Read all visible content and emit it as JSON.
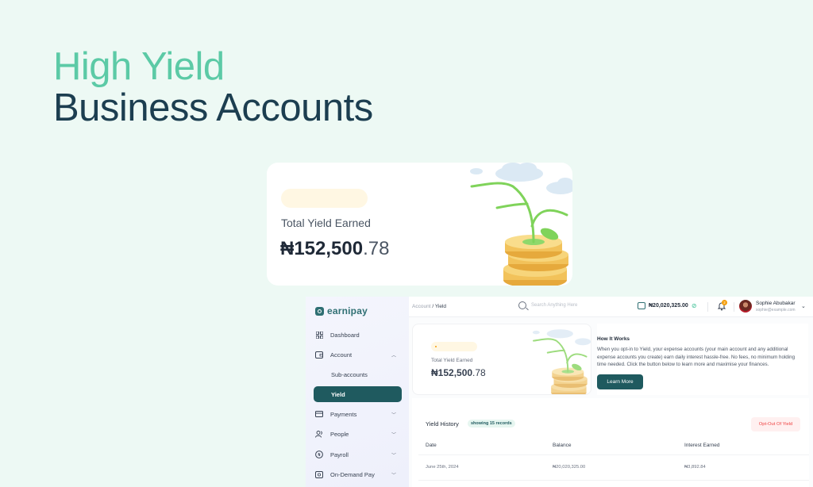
{
  "hero": {
    "line1": "High Yield",
    "line2": "Business Accounts"
  },
  "colors": {
    "accent_green": "#5ccaa6",
    "navy": "#1c3e50",
    "primary_teal": "#1f5a5f",
    "danger": "#ef4444",
    "background": "#edf9f4"
  },
  "feature_card": {
    "label": "Total Yield Earned",
    "amount_main": "₦152,500",
    "amount_decimal": ".78",
    "illustration": "plant-on-coin-stack"
  },
  "app": {
    "logo": "earnipay",
    "sidebar": {
      "items": [
        {
          "label": "Dashboard",
          "icon": "dashboard-grid-icon"
        },
        {
          "label": "Account",
          "icon": "wallet-icon",
          "chevron": "chevron-up-icon"
        },
        {
          "label": "Sub-accounts"
        },
        {
          "label": "Yield",
          "active": true
        },
        {
          "label": "Payments",
          "icon": "card-icon",
          "chevron": "chevron-down-icon"
        },
        {
          "label": "People",
          "icon": "people-icon",
          "chevron": "chevron-down-icon"
        },
        {
          "label": "Payroll",
          "icon": "naira-circle-icon",
          "chevron": "chevron-down-icon"
        },
        {
          "label": "On-Demand Pay",
          "icon": "cash-icon",
          "chevron": "chevron-down-icon"
        }
      ]
    },
    "topbar": {
      "breadcrumb_parent": "Account",
      "breadcrumb_sep": "/",
      "breadcrumb_current": "Yield",
      "search_placeholder": "Search Anything Here",
      "balance": "₦20,020,325.00",
      "notification_count": "2",
      "user_name": "Sophie Abubakar",
      "user_email": "sophie@example.com"
    },
    "yield_card": {
      "label": "Total Yield Earned",
      "amount_main": "₦152,500",
      "amount_decimal": ".78"
    },
    "how_it_works": {
      "title": "How It Works",
      "body": "When you opt-in to Yield, your expense accounts (your main account and any additional expense accounts you create) earn daily interest hassle-free. No fees, no minimum holding time needed. Click the button below to learn more and maximise your finances.",
      "button": "Learn More"
    },
    "history": {
      "title": "Yield History",
      "badge": "showing 15 records",
      "opt_out_button": "Opt-Out Of Yield",
      "columns": [
        "Date",
        "Balance",
        "Interest Earned"
      ],
      "rows": [
        {
          "date": "June 25th, 2024",
          "balance": "₦20,020,325.00",
          "interest": "₦3,892.84"
        }
      ]
    }
  }
}
